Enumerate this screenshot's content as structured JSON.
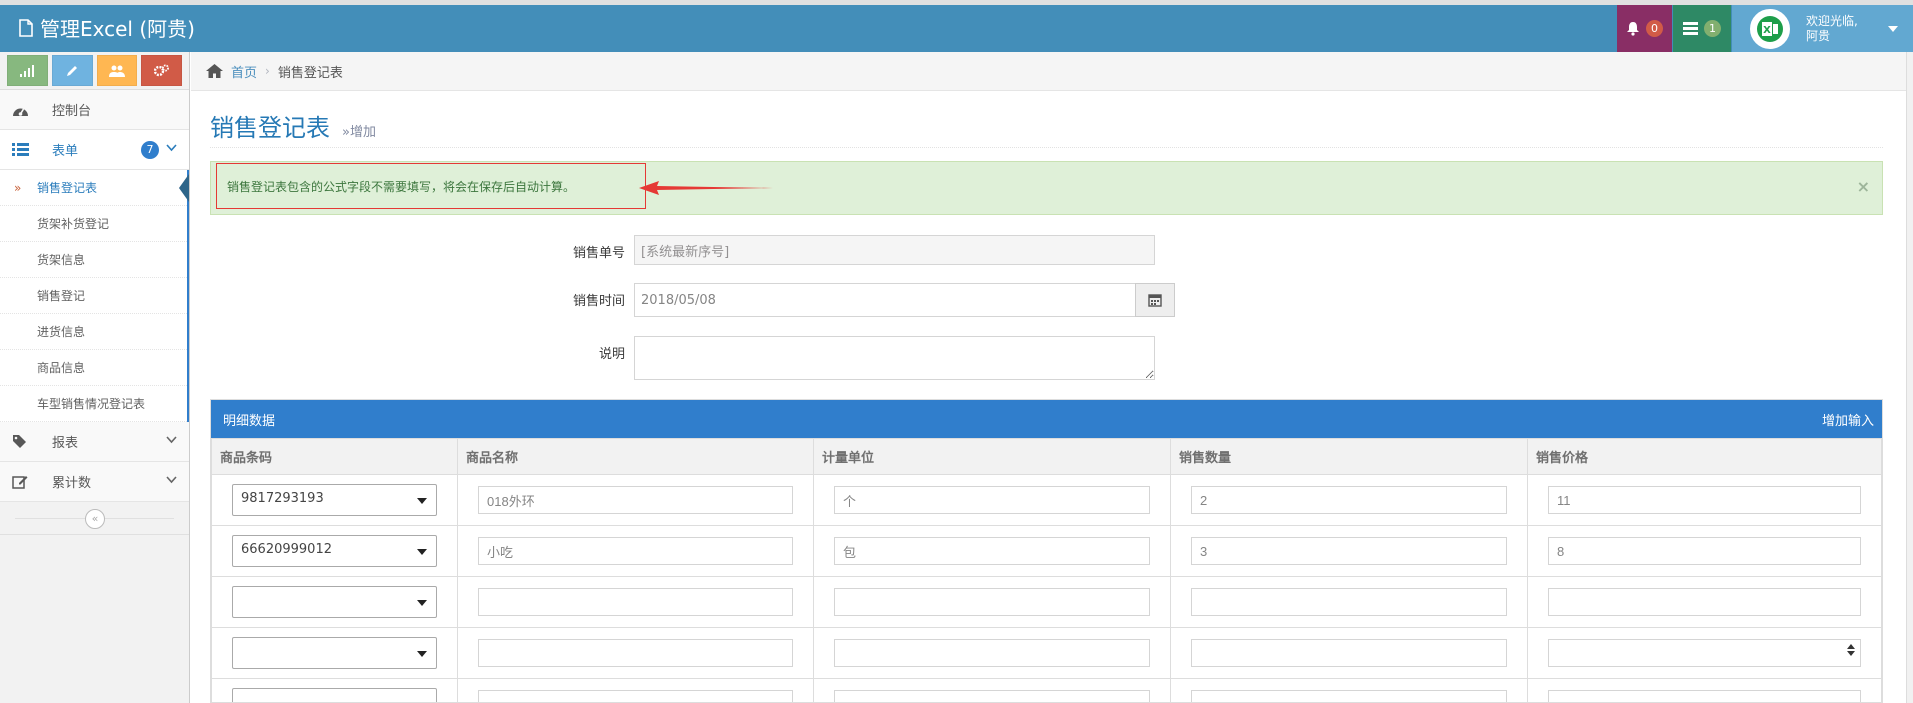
{
  "navbar": {
    "title": "管理Excel (阿贵)",
    "notifications_count": "0",
    "tasks_count": "1",
    "user_greeting": "欢迎光临,",
    "user_name": "阿贵"
  },
  "sidebar": {
    "shortcuts": [
      "signal-icon",
      "pencil-icon",
      "users-icon",
      "cogs-icon"
    ],
    "items": [
      {
        "label": "控制台",
        "icon": "dashboard-icon"
      },
      {
        "label": "表单",
        "icon": "list-icon",
        "badge": "7"
      },
      {
        "label": "报表",
        "icon": "tag-icon"
      },
      {
        "label": "累计数",
        "icon": "edit-icon"
      }
    ],
    "form_children": [
      "销售登记表",
      "货架补货登记",
      "货架信息",
      "销售登记",
      "进货信息",
      "商品信息",
      "车型销售情况登记表"
    ],
    "collapse_glyph": "«"
  },
  "breadcrumb": {
    "home": "首页",
    "current": "销售登记表"
  },
  "page": {
    "title": "销售登记表",
    "subtitle": "»增加"
  },
  "alert": {
    "message": "销售登记表包含的公式字段不需要填写，将会在保存后自动计算。",
    "close": "×"
  },
  "form": {
    "order_no_label": "销售单号",
    "order_no_value": "[系统最新序号]",
    "time_label": "销售时间",
    "time_value": "2018/05/08",
    "note_label": "说明",
    "note_value": ""
  },
  "detail": {
    "title": "明细数据",
    "add_label": "增加输入",
    "columns": [
      "商品条码",
      "商品名称",
      "计量单位",
      "销售数量",
      "销售价格"
    ],
    "rows": [
      {
        "barcode": "9817293193",
        "name": "018外环",
        "unit": "个",
        "qty": "2",
        "price": "11"
      },
      {
        "barcode": "66620999012",
        "name": "小吃",
        "unit": "包",
        "qty": "3",
        "price": "8"
      },
      {
        "barcode": "",
        "name": "",
        "unit": "",
        "qty": "",
        "price": ""
      },
      {
        "barcode": "",
        "name": "",
        "unit": "",
        "qty": "",
        "price": ""
      },
      {
        "barcode": "",
        "name": "",
        "unit": "",
        "qty": "",
        "price": ""
      }
    ]
  },
  "colors": {
    "navbar": "#438eb9",
    "accent": "#307ecc",
    "alert_bg": "#dff0d8",
    "annotation_red": "#e53935"
  }
}
